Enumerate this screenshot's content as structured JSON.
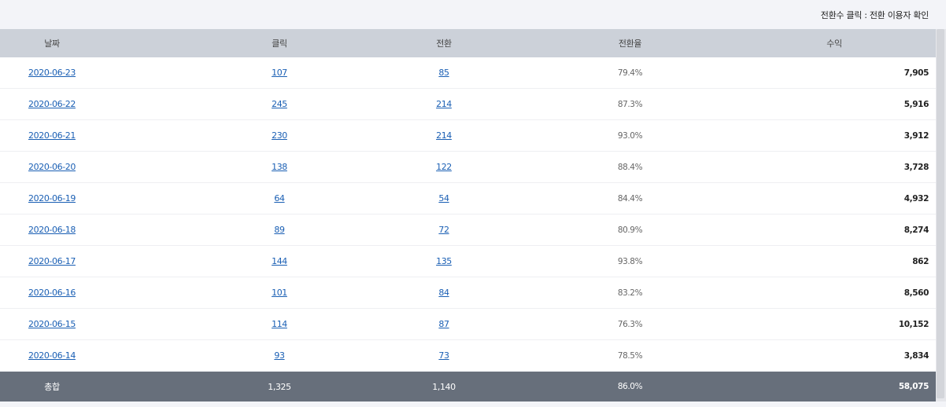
{
  "top_note": "전환수 클릭 : 전환 이용자 확인",
  "headers": {
    "date": "날짜",
    "click": "클릭",
    "conversion": "전환",
    "rate": "전환율",
    "revenue": "수익"
  },
  "rows": [
    {
      "date": "2020-06-23",
      "click": "107",
      "conversion": "85",
      "rate": "79.4%",
      "revenue": "7,905"
    },
    {
      "date": "2020-06-22",
      "click": "245",
      "conversion": "214",
      "rate": "87.3%",
      "revenue": "5,916"
    },
    {
      "date": "2020-06-21",
      "click": "230",
      "conversion": "214",
      "rate": "93.0%",
      "revenue": "3,912"
    },
    {
      "date": "2020-06-20",
      "click": "138",
      "conversion": "122",
      "rate": "88.4%",
      "revenue": "3,728"
    },
    {
      "date": "2020-06-19",
      "click": "64",
      "conversion": "54",
      "rate": "84.4%",
      "revenue": "4,932"
    },
    {
      "date": "2020-06-18",
      "click": "89",
      "conversion": "72",
      "rate": "80.9%",
      "revenue": "8,274"
    },
    {
      "date": "2020-06-17",
      "click": "144",
      "conversion": "135",
      "rate": "93.8%",
      "revenue": "862"
    },
    {
      "date": "2020-06-16",
      "click": "101",
      "conversion": "84",
      "rate": "83.2%",
      "revenue": "8,560"
    },
    {
      "date": "2020-06-15",
      "click": "114",
      "conversion": "87",
      "rate": "76.3%",
      "revenue": "10,152"
    },
    {
      "date": "2020-06-14",
      "click": "93",
      "conversion": "73",
      "rate": "78.5%",
      "revenue": "3,834"
    }
  ],
  "total": {
    "label": "총합",
    "click": "1,325",
    "conversion": "1,140",
    "rate": "86.0%",
    "revenue": "58,075"
  },
  "colors": {
    "header_bg": "#ccd1d9",
    "total_bg": "#676f7b",
    "link": "#1a5fb4"
  }
}
